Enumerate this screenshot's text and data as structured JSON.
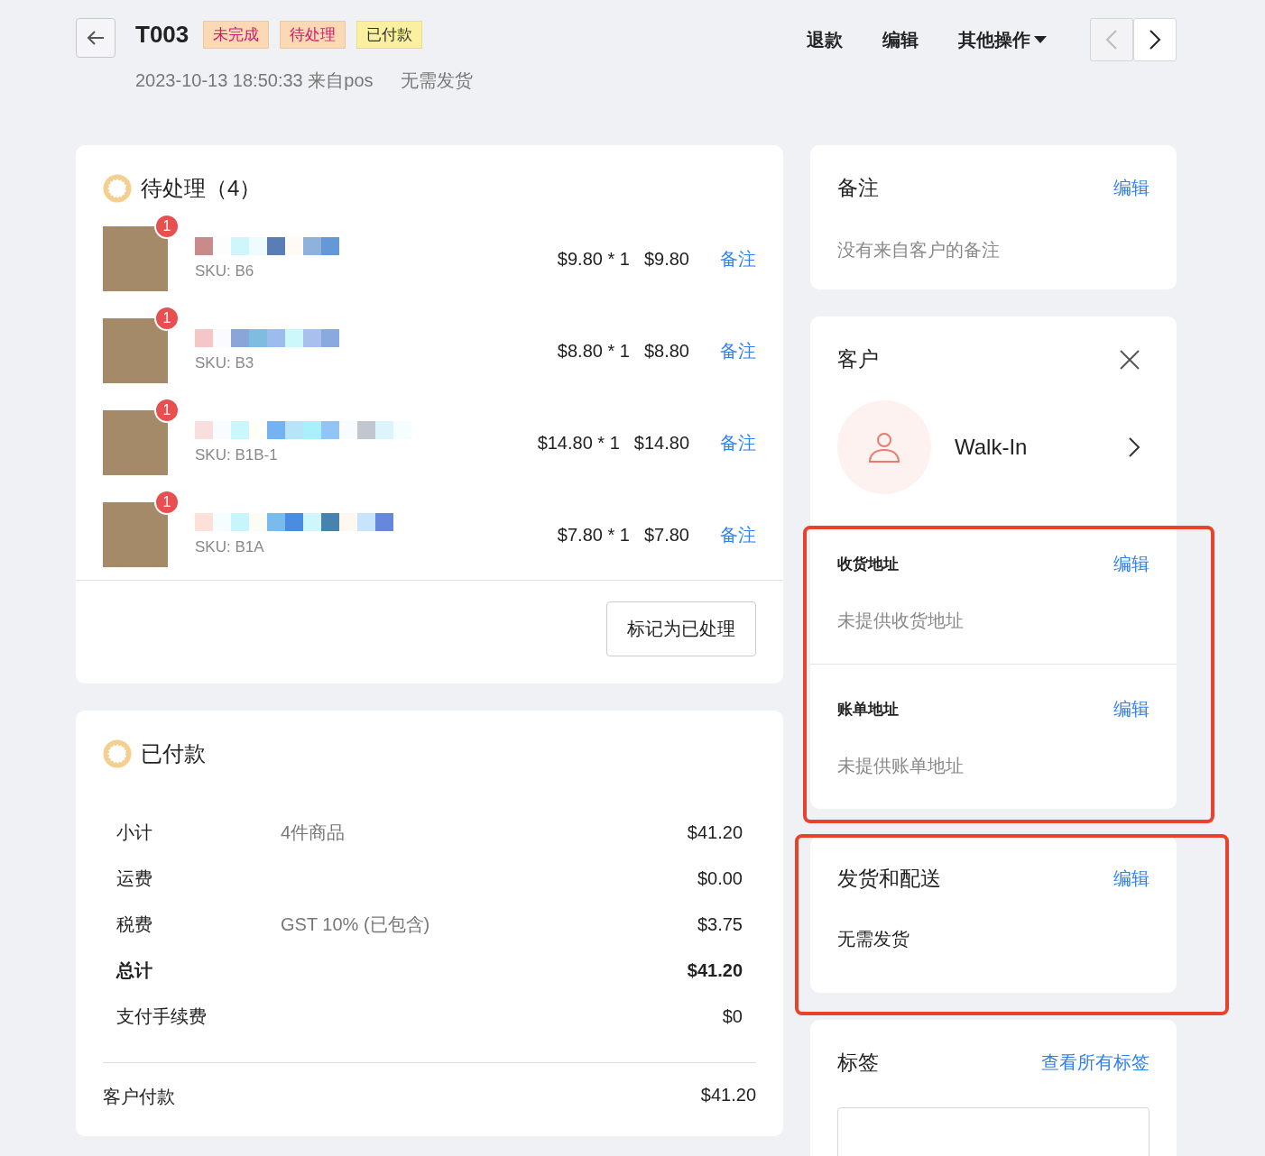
{
  "header": {
    "order_id": "T003",
    "tags": [
      {
        "label": "未完成",
        "color": "#fbd9b5"
      },
      {
        "label": "待处理",
        "color": "#fbd9b5"
      },
      {
        "label": "已付款",
        "color": "#fbf0a0"
      }
    ],
    "meta": "2023-10-13 18:50:33 来自pos",
    "shipping_note": "无需发货",
    "actions": [
      {
        "label": "退款",
        "kind": "plain"
      },
      {
        "label": "编辑",
        "kind": "plain"
      },
      {
        "label": "其他操作",
        "kind": "dropdown"
      }
    ],
    "nav": [
      {
        "kind": "prev",
        "disabled": true
      },
      {
        "kind": "next",
        "disabled": false
      }
    ]
  },
  "pending": {
    "title": "待处理（4）",
    "items": [
      {
        "badge": "1",
        "sku": "SKU: B6",
        "price": "$9.80 * 1",
        "total": "$9.80",
        "note": "备注"
      },
      {
        "badge": "1",
        "sku": "SKU: B3",
        "price": "$8.80 * 1",
        "total": "$8.80",
        "note": "备注"
      },
      {
        "badge": "1",
        "sku": "SKU: B1B-1",
        "price": "$14.80 * 1",
        "total": "$14.80",
        "note": "备注"
      },
      {
        "badge": "1",
        "sku": "SKU: B1A",
        "price": "$7.80 * 1",
        "total": "$7.80",
        "note": "备注"
      }
    ],
    "button": "标记为已处理"
  },
  "payment": {
    "title": "已付款",
    "rows": [
      {
        "label": "小计",
        "detail": "4件商品",
        "amount": "$41.20",
        "kind": "normal"
      },
      {
        "label": "运费",
        "amount": "$0.00",
        "kind": "normal"
      },
      {
        "label": "税费",
        "detail": "GST 10% (已包含)",
        "amount": "$3.75",
        "kind": "normal"
      },
      {
        "label": "总计",
        "amount": "$41.20",
        "kind": "total"
      },
      {
        "label": "支付手续费",
        "amount": "$0",
        "kind": "normal"
      }
    ],
    "paid_label": "客户付款",
    "paid_amount": "$41.20"
  },
  "notes": {
    "title": "备注",
    "action": "编辑",
    "text": "没有来自客户的备注"
  },
  "customer": {
    "title": "客户",
    "name": "Walk-In",
    "shipping_address": {
      "title": "收货地址",
      "action": "编辑",
      "text": "未提供收货地址"
    },
    "billing_address": {
      "title": "账单地址",
      "action": "编辑",
      "text": "未提供账单地址"
    }
  },
  "delivery": {
    "title": "发货和配送",
    "action": "编辑",
    "text": "无需发货"
  },
  "labels": {
    "title": "标签",
    "action": "查看所有标签"
  }
}
